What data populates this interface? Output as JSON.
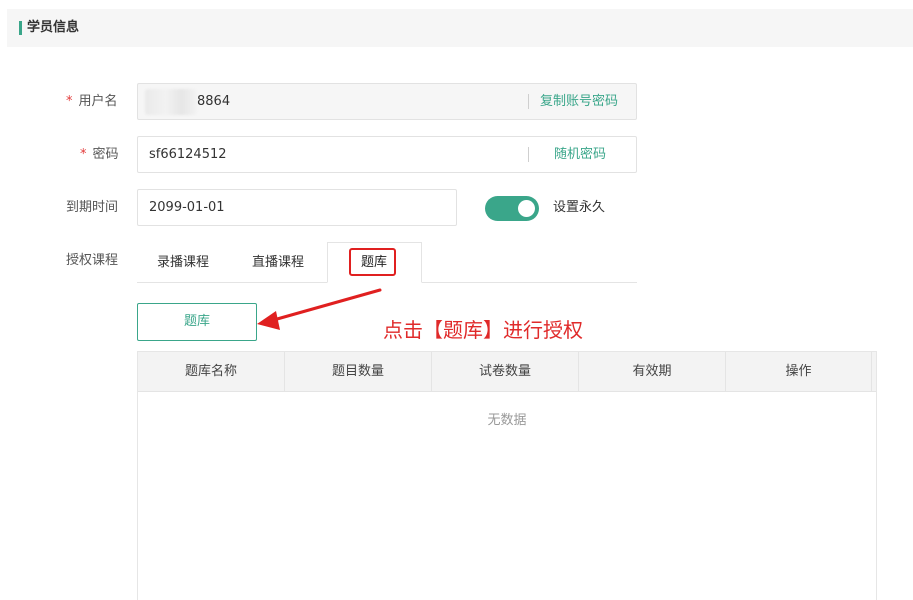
{
  "header": {
    "title": "学员信息"
  },
  "form": {
    "username": {
      "label": "用户名",
      "required_mark": "*",
      "value": "8864",
      "action": "复制账号密码"
    },
    "password": {
      "label": "密码",
      "required_mark": "*",
      "value": "sf66124512",
      "action": "随机密码"
    },
    "expiry": {
      "label": "到期时间",
      "value": "2099-01-01",
      "toggle_label": "设置永久",
      "toggle_on": true
    },
    "course_auth": {
      "label": "授权课程"
    }
  },
  "tabs": [
    {
      "label": "录播课程",
      "active": false
    },
    {
      "label": "直播课程",
      "active": false
    },
    {
      "label": "题库",
      "active": true
    }
  ],
  "question_bank_button": "题库",
  "annotation": "点击【题库】进行授权",
  "table": {
    "columns": [
      "题库名称",
      "题目数量",
      "试卷数量",
      "有效期",
      "操作"
    ],
    "empty_text": "无数据"
  },
  "colors": {
    "accent": "#3aa68a",
    "annotation_red": "#e02020"
  }
}
